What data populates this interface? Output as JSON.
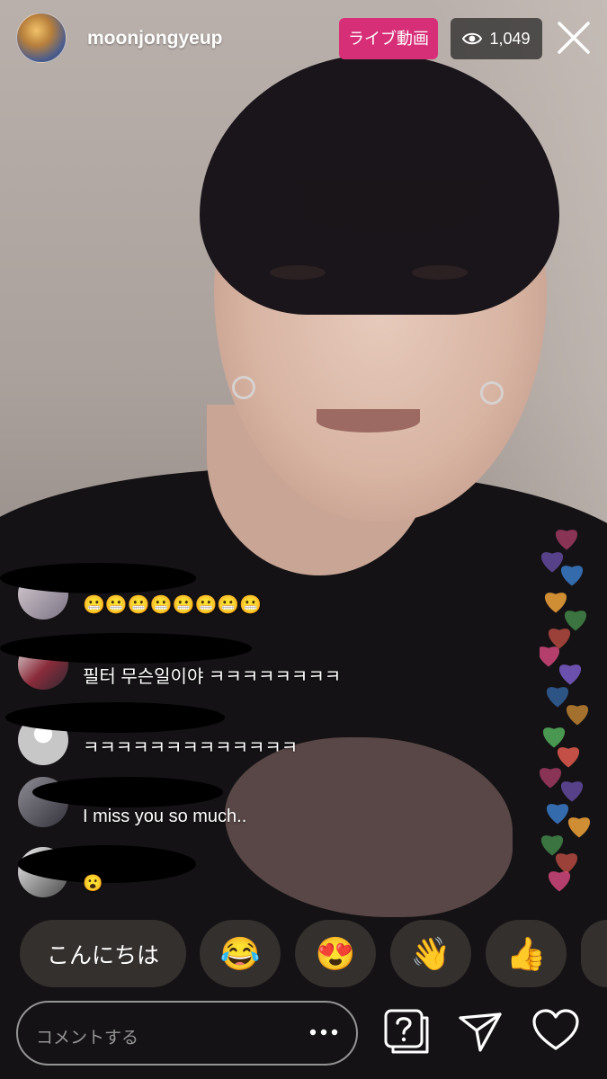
{
  "header": {
    "username": "moonjongyeup",
    "live_label": "ライブ動画",
    "viewer_count": "1,049"
  },
  "comments": [
    {
      "text": "😬😬😬😬😬😬😬😬"
    },
    {
      "text": "필터 무슨일이야 ㅋㅋㅋㅋㅋㅋㅋㅋ"
    },
    {
      "text": "ㅋㅋㅋㅋㅋㅋㅋㅋㅋㅋㅋㅋㅋ"
    },
    {
      "text": "I miss you so much.."
    },
    {
      "text": "😮"
    }
  ],
  "quick_replies": [
    {
      "label": "こんにちは"
    },
    {
      "emoji": "😂"
    },
    {
      "emoji": "😍"
    },
    {
      "emoji": "👋"
    },
    {
      "emoji": "👍"
    }
  ],
  "comment_box": {
    "placeholder": "コメントする"
  },
  "colors": {
    "live_badge": "#d62f77",
    "heart_palette": [
      "#e94f8b",
      "#7b5cc9",
      "#3f8ae0",
      "#f0a33a",
      "#5cc466",
      "#e35b4f"
    ]
  },
  "icons": [
    "close-icon",
    "eye-icon",
    "more-icon",
    "question-icon",
    "send-icon",
    "heart-icon"
  ]
}
